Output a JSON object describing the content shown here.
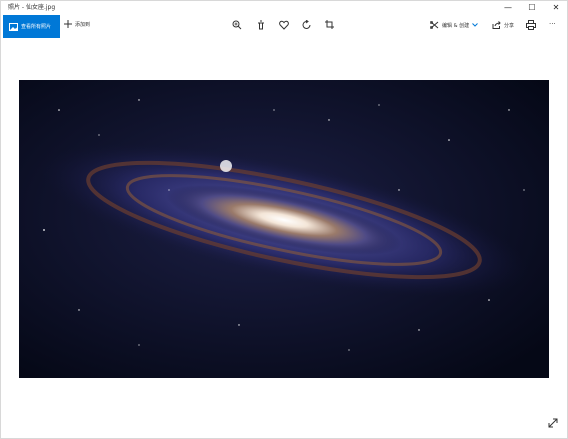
{
  "window": {
    "title": "照片 - 仙女座.jpg",
    "controls": [
      "—",
      "☐",
      "✕"
    ]
  },
  "toolbar": {
    "view_all_label": "查看所有照片",
    "add_label": "添加到",
    "edit_create_label": "编辑 & 创建",
    "share_label": "分享",
    "more_label": "···"
  },
  "colors": {
    "accent": "#0078d7",
    "background": "#ffffff"
  },
  "image": {
    "description_text": ""
  }
}
